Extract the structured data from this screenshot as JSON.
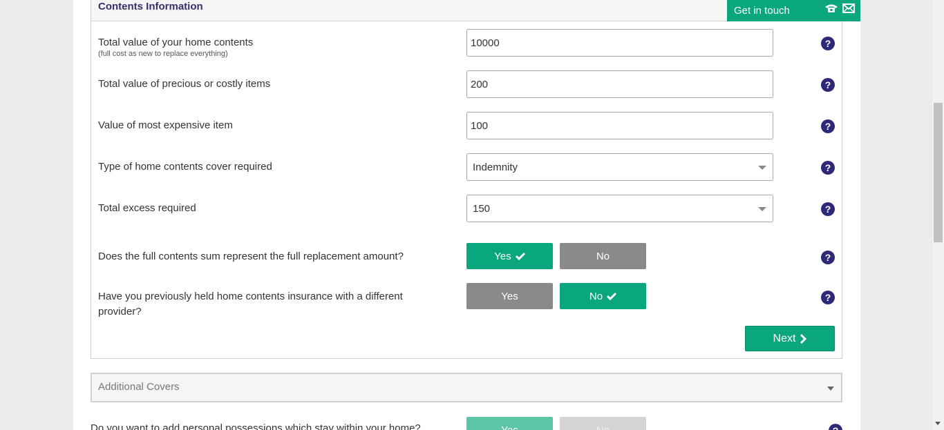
{
  "section": {
    "title": "Contents Information"
  },
  "get_in_touch": {
    "label": "Get in touch",
    "icons": [
      "phone-icon",
      "envelope-icon"
    ]
  },
  "rows": [
    {
      "label": "Total value of your home contents",
      "sublabel": "(full cost as new to replace everything)",
      "value": "10000"
    },
    {
      "label": "Total value of precious or costly items",
      "value": "200"
    },
    {
      "label": "Value of most expensive item",
      "value": "100"
    },
    {
      "label": "Type of home contents cover required",
      "value": "Indemnity"
    },
    {
      "label": "Total excess required",
      "value": "150"
    }
  ],
  "questions": [
    {
      "label": "Does the full contents sum represent the full replacement amount?",
      "yes": "Yes",
      "no": "No",
      "selected": "Yes"
    },
    {
      "label_line1": "Have you previously held home contents insurance with a different",
      "label_line2": "provider?",
      "yes": "Yes",
      "no": "No",
      "selected": "No"
    }
  ],
  "help_glyph": "?",
  "next_button": {
    "label": "Next"
  },
  "additional": {
    "title": "Additional Covers"
  },
  "partial_question": {
    "label": "Do you want to add personal possessions which stay within your home?",
    "yes": "Yes",
    "no": "No"
  },
  "colors": {
    "accent": "#0aa67e",
    "help": "#2d2878",
    "title": "#35306b",
    "inactive": "#8a8a8a"
  }
}
